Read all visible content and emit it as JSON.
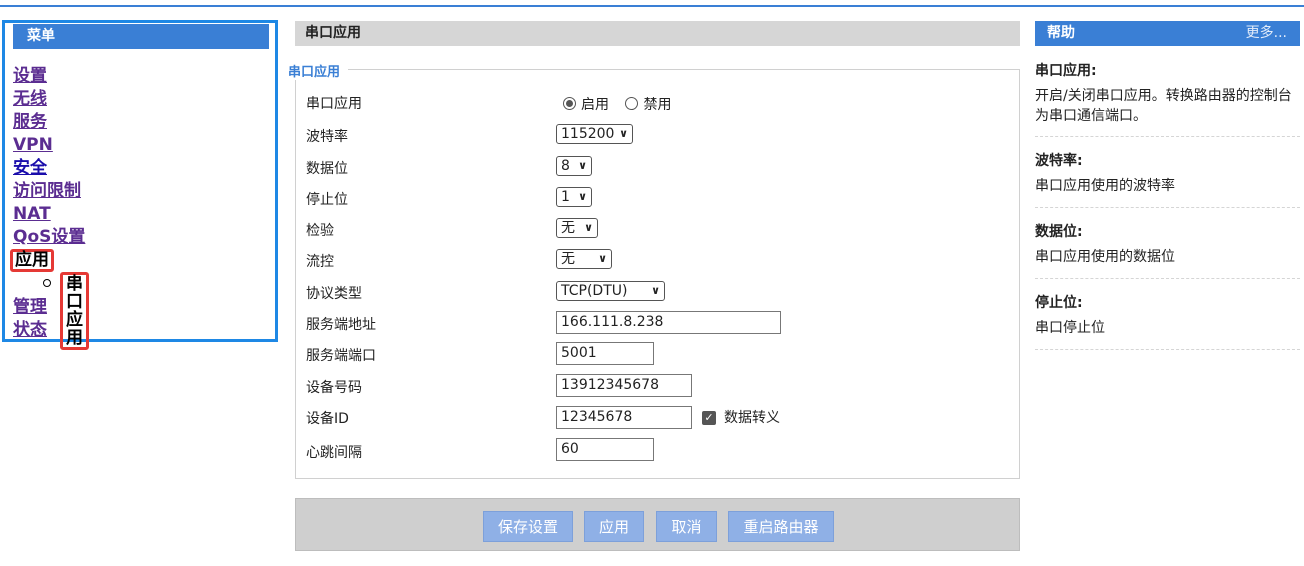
{
  "sidebar": {
    "title": "菜单",
    "items": [
      {
        "label": "设置"
      },
      {
        "label": "无线"
      },
      {
        "label": "服务"
      },
      {
        "label": "VPN"
      },
      {
        "label": "安全"
      },
      {
        "label": "访问限制"
      },
      {
        "label": "NAT"
      },
      {
        "label": "QoS设置"
      },
      {
        "label": "应用"
      },
      {
        "label": "管理"
      },
      {
        "label": "状态"
      }
    ],
    "subitem": "串口应用"
  },
  "main": {
    "title": "串口应用",
    "section": "串口应用",
    "fields": {
      "serial_app": {
        "label": "串口应用",
        "opt_on": "启用",
        "opt_off": "禁用",
        "selected": "启用"
      },
      "baud": {
        "label": "波特率",
        "value": "115200"
      },
      "databits": {
        "label": "数据位",
        "value": "8"
      },
      "stopbits": {
        "label": "停止位",
        "value": "1"
      },
      "parity": {
        "label": "检验",
        "value": "无"
      },
      "flow": {
        "label": "流控",
        "value": "无"
      },
      "protocol": {
        "label": "协议类型",
        "value": "TCP(DTU)"
      },
      "server_addr": {
        "label": "服务端地址",
        "value": "166.111.8.238"
      },
      "server_port": {
        "label": "服务端端口",
        "value": "5001"
      },
      "device_no": {
        "label": "设备号码",
        "value": "13912345678"
      },
      "device_id": {
        "label": "设备ID",
        "value": "12345678",
        "escape_label": "数据转义",
        "escape_checked": true
      },
      "heartbeat": {
        "label": "心跳间隔",
        "value": "60"
      }
    },
    "buttons": {
      "save": "保存设置",
      "apply": "应用",
      "cancel": "取消",
      "reboot": "重启路由器"
    }
  },
  "help": {
    "title": "帮助",
    "more": "更多...",
    "sections": [
      {
        "title": "串口应用:",
        "text": "开启/关闭串口应用。转换路由器的控制台为串口通信端口。"
      },
      {
        "title": "波特率:",
        "text": "串口应用使用的波特率"
      },
      {
        "title": "数据位:",
        "text": "串口应用使用的数据位"
      },
      {
        "title": "停止位:",
        "text": "串口停止位"
      }
    ]
  },
  "colors": {
    "accent": "#3a7fd5",
    "highlight": "#e53935",
    "button": "#8fb0e6"
  }
}
